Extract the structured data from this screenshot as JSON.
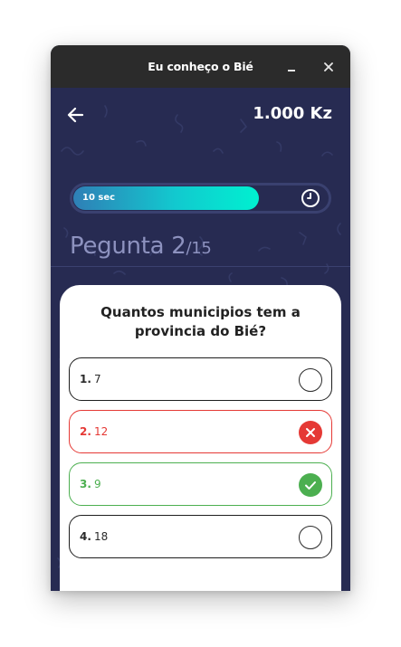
{
  "window": {
    "title": "Eu conheço o Bié",
    "controls": [
      "minimize-icon",
      "close-icon"
    ]
  },
  "header": {
    "back_icon": "arrow-left-icon",
    "balance": "1.000 Kz"
  },
  "timer": {
    "label": "10 sec",
    "progress": 0.73,
    "icon": "clock-icon",
    "fill_gradient": [
      "#2f7fb6",
      "#00f0d0"
    ]
  },
  "question": {
    "prefix": "Pegunta 2",
    "total": "/15",
    "text": "Quantos municipios tem a provincia do Bié?"
  },
  "options": [
    {
      "number": "1.",
      "value": "7",
      "state": "unanswered"
    },
    {
      "number": "2.",
      "value": "12",
      "state": "wrong"
    },
    {
      "number": "3.",
      "value": "9",
      "state": "correct"
    },
    {
      "number": "4.",
      "value": "18",
      "state": "unanswered"
    }
  ],
  "colors": {
    "background": "#272b52",
    "wrong": "#e53935",
    "correct": "#4caf50",
    "card": "#ffffff",
    "muted_text": "#8d92bf"
  }
}
